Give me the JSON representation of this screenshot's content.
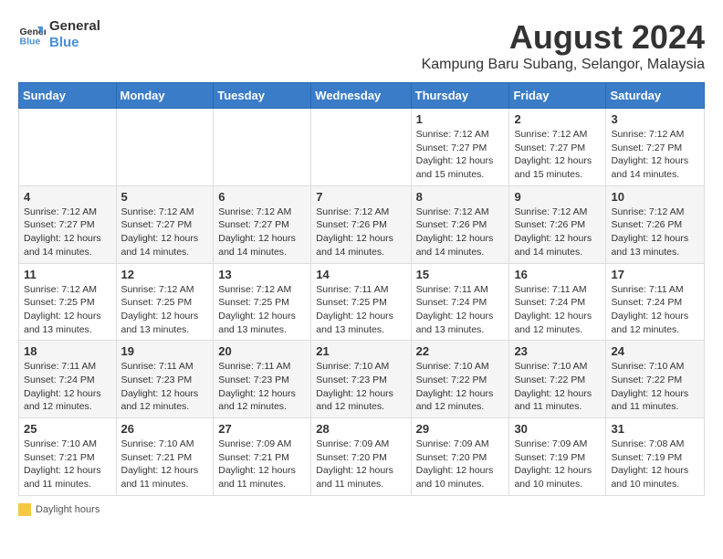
{
  "header": {
    "logo_line1": "General",
    "logo_line2": "Blue",
    "month_year": "August 2024",
    "location": "Kampung Baru Subang, Selangor, Malaysia"
  },
  "weekdays": [
    "Sunday",
    "Monday",
    "Tuesday",
    "Wednesday",
    "Thursday",
    "Friday",
    "Saturday"
  ],
  "footer": {
    "daylight_label": "Daylight hours"
  },
  "weeks": [
    {
      "days": [
        {
          "num": "",
          "info": ""
        },
        {
          "num": "",
          "info": ""
        },
        {
          "num": "",
          "info": ""
        },
        {
          "num": "",
          "info": ""
        },
        {
          "num": "1",
          "info": "Sunrise: 7:12 AM\nSunset: 7:27 PM\nDaylight: 12 hours\nand 15 minutes."
        },
        {
          "num": "2",
          "info": "Sunrise: 7:12 AM\nSunset: 7:27 PM\nDaylight: 12 hours\nand 15 minutes."
        },
        {
          "num": "3",
          "info": "Sunrise: 7:12 AM\nSunset: 7:27 PM\nDaylight: 12 hours\nand 14 minutes."
        }
      ]
    },
    {
      "days": [
        {
          "num": "4",
          "info": "Sunrise: 7:12 AM\nSunset: 7:27 PM\nDaylight: 12 hours\nand 14 minutes."
        },
        {
          "num": "5",
          "info": "Sunrise: 7:12 AM\nSunset: 7:27 PM\nDaylight: 12 hours\nand 14 minutes."
        },
        {
          "num": "6",
          "info": "Sunrise: 7:12 AM\nSunset: 7:27 PM\nDaylight: 12 hours\nand 14 minutes."
        },
        {
          "num": "7",
          "info": "Sunrise: 7:12 AM\nSunset: 7:26 PM\nDaylight: 12 hours\nand 14 minutes."
        },
        {
          "num": "8",
          "info": "Sunrise: 7:12 AM\nSunset: 7:26 PM\nDaylight: 12 hours\nand 14 minutes."
        },
        {
          "num": "9",
          "info": "Sunrise: 7:12 AM\nSunset: 7:26 PM\nDaylight: 12 hours\nand 14 minutes."
        },
        {
          "num": "10",
          "info": "Sunrise: 7:12 AM\nSunset: 7:26 PM\nDaylight: 12 hours\nand 13 minutes."
        }
      ]
    },
    {
      "days": [
        {
          "num": "11",
          "info": "Sunrise: 7:12 AM\nSunset: 7:25 PM\nDaylight: 12 hours\nand 13 minutes."
        },
        {
          "num": "12",
          "info": "Sunrise: 7:12 AM\nSunset: 7:25 PM\nDaylight: 12 hours\nand 13 minutes."
        },
        {
          "num": "13",
          "info": "Sunrise: 7:12 AM\nSunset: 7:25 PM\nDaylight: 12 hours\nand 13 minutes."
        },
        {
          "num": "14",
          "info": "Sunrise: 7:11 AM\nSunset: 7:25 PM\nDaylight: 12 hours\nand 13 minutes."
        },
        {
          "num": "15",
          "info": "Sunrise: 7:11 AM\nSunset: 7:24 PM\nDaylight: 12 hours\nand 13 minutes."
        },
        {
          "num": "16",
          "info": "Sunrise: 7:11 AM\nSunset: 7:24 PM\nDaylight: 12 hours\nand 12 minutes."
        },
        {
          "num": "17",
          "info": "Sunrise: 7:11 AM\nSunset: 7:24 PM\nDaylight: 12 hours\nand 12 minutes."
        }
      ]
    },
    {
      "days": [
        {
          "num": "18",
          "info": "Sunrise: 7:11 AM\nSunset: 7:24 PM\nDaylight: 12 hours\nand 12 minutes."
        },
        {
          "num": "19",
          "info": "Sunrise: 7:11 AM\nSunset: 7:23 PM\nDaylight: 12 hours\nand 12 minutes."
        },
        {
          "num": "20",
          "info": "Sunrise: 7:11 AM\nSunset: 7:23 PM\nDaylight: 12 hours\nand 12 minutes."
        },
        {
          "num": "21",
          "info": "Sunrise: 7:10 AM\nSunset: 7:23 PM\nDaylight: 12 hours\nand 12 minutes."
        },
        {
          "num": "22",
          "info": "Sunrise: 7:10 AM\nSunset: 7:22 PM\nDaylight: 12 hours\nand 12 minutes."
        },
        {
          "num": "23",
          "info": "Sunrise: 7:10 AM\nSunset: 7:22 PM\nDaylight: 12 hours\nand 11 minutes."
        },
        {
          "num": "24",
          "info": "Sunrise: 7:10 AM\nSunset: 7:22 PM\nDaylight: 12 hours\nand 11 minutes."
        }
      ]
    },
    {
      "days": [
        {
          "num": "25",
          "info": "Sunrise: 7:10 AM\nSunset: 7:21 PM\nDaylight: 12 hours\nand 11 minutes."
        },
        {
          "num": "26",
          "info": "Sunrise: 7:10 AM\nSunset: 7:21 PM\nDaylight: 12 hours\nand 11 minutes."
        },
        {
          "num": "27",
          "info": "Sunrise: 7:09 AM\nSunset: 7:21 PM\nDaylight: 12 hours\nand 11 minutes."
        },
        {
          "num": "28",
          "info": "Sunrise: 7:09 AM\nSunset: 7:20 PM\nDaylight: 12 hours\nand 11 minutes."
        },
        {
          "num": "29",
          "info": "Sunrise: 7:09 AM\nSunset: 7:20 PM\nDaylight: 12 hours\nand 10 minutes."
        },
        {
          "num": "30",
          "info": "Sunrise: 7:09 AM\nSunset: 7:19 PM\nDaylight: 12 hours\nand 10 minutes."
        },
        {
          "num": "31",
          "info": "Sunrise: 7:08 AM\nSunset: 7:19 PM\nDaylight: 12 hours\nand 10 minutes."
        }
      ]
    }
  ]
}
